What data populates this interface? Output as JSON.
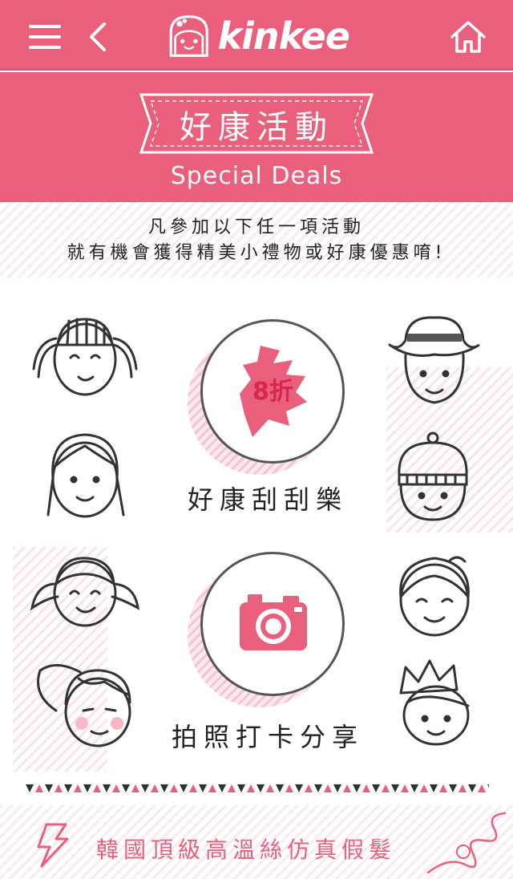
{
  "header": {
    "logo_text": "kinkee",
    "menu_icon": "hamburger-menu-icon",
    "back_icon": "chevron-left-icon",
    "home_icon": "home-icon"
  },
  "banner": {
    "title": "好康活動",
    "subtitle": "Special Deals"
  },
  "intro": {
    "line1": "凡參加以下任一項活動",
    "line2": "就有機會獲得精美小禮物或好康優惠唷!"
  },
  "activities": [
    {
      "label": "好康刮刮樂",
      "badge": "8折",
      "icon": "scratch-card-icon"
    },
    {
      "label": "拍照打卡分享",
      "icon": "camera-icon"
    }
  ],
  "bottom": {
    "label": "韓國頂級高溫絲仿真假髮",
    "icon": "lightning-icon"
  },
  "colors": {
    "brand": "#e95f7c",
    "accent": "#d8274f",
    "text": "#222222"
  }
}
